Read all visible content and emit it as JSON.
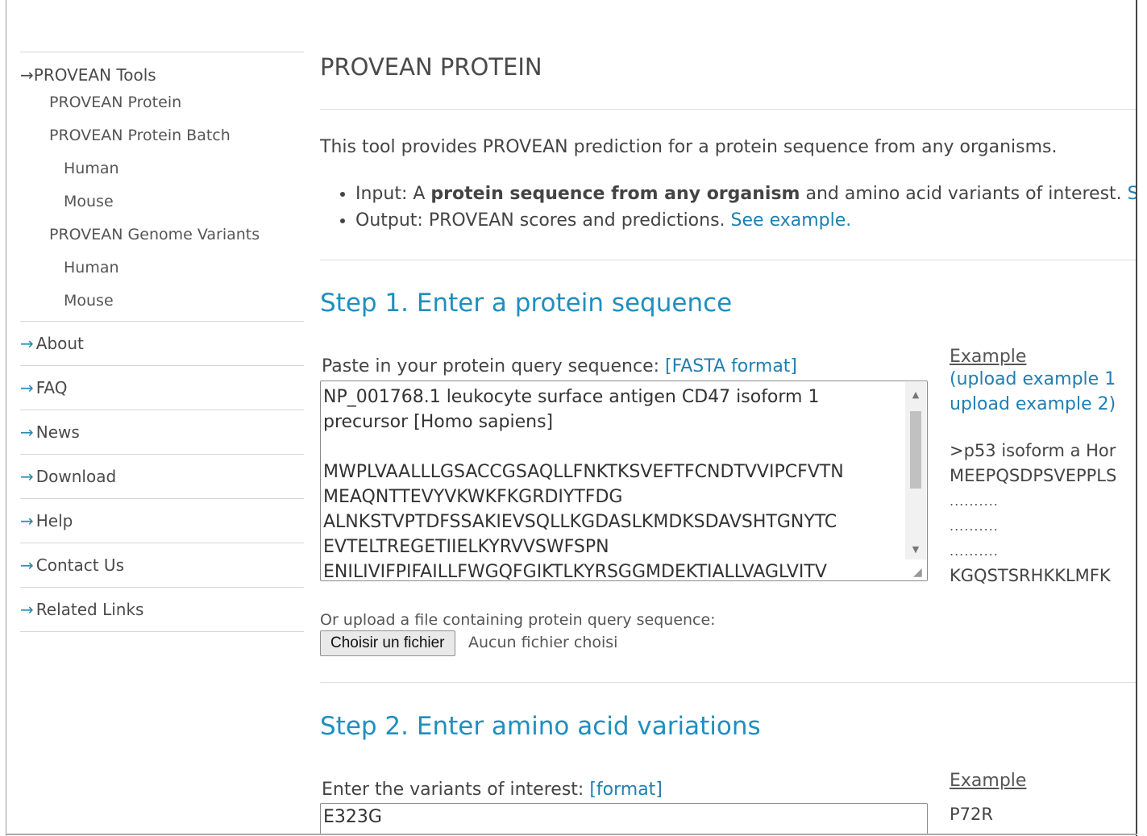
{
  "sidebar": {
    "tools_heading": "PROVEAN Tools",
    "protein": "PROVEAN Protein",
    "protein_batch": "PROVEAN Protein Batch",
    "batch_human": "Human",
    "batch_mouse": "Mouse",
    "genome_variants": "PROVEAN Genome Variants",
    "genome_human": "Human",
    "genome_mouse": "Mouse",
    "about": "About",
    "faq": "FAQ",
    "news": "News",
    "download": "Download",
    "help": "Help",
    "contact": "Contact Us",
    "related_links": "Related Links"
  },
  "main": {
    "title": "PROVEAN PROTEIN",
    "intro": "This tool provides PROVEAN prediction for a protein sequence from any organisms.",
    "bullet_input_prefix": "Input: A ",
    "bullet_input_bold": "protein sequence from any organism",
    "bullet_input_suffix": " and amino acid variants of interest. ",
    "bullet_input_link": "S",
    "bullet_output_prefix": "Output: PROVEAN scores and predictions. ",
    "bullet_output_link": "See example."
  },
  "step1": {
    "heading": "Step 1. Enter a protein sequence",
    "paste_label": "Paste in your protein query sequence: ",
    "fasta_link": "[FASTA format]",
    "sequence": "NP_001768.1 leukocyte surface antigen CD47 isoform 1\nprecursor [Homo sapiens]\n\nMWPLVAALLLGSACCGSAQLLFNKTKSVEFTFCNDTVVIPCFVTN\nMEAQNTTEVYVKWKFKGRDIYTFDG\nALNKSTVPTDFSSAKIEVSQLLKGDASLKMDKSDAVSHTGNYTC\nEVTELTREGETIIELKYRVVSWFSPN\nENILIVIFPIFAILLFWGQFGIKTLKYRSGGMDEKTIALLVAGLVITV",
    "upload_label": "Or upload a file containing protein query sequence:",
    "choose_file": "Choisir un fichier",
    "no_file": "Aucun fichier choisi",
    "example_heading": "Example",
    "upload_example_1": "(upload example 1",
    "upload_example_2": "upload example 2)",
    "example_line_1": ">p53 isoform a Hor",
    "example_line_2": "MEEPQSDPSVEPPLS",
    "example_dots_1": "..........",
    "example_dots_2": "..........",
    "example_dots_3": "..........",
    "example_line_3": "KGQSTSRHKKLMFK"
  },
  "step2": {
    "heading": "Step 2. Enter amino acid variations",
    "variants_label": "Enter the variants of interest: ",
    "format_link": "[format]",
    "variants_value": "E323G",
    "example_heading": "Example",
    "example_line_1": "P72R"
  },
  "colors": {
    "link": "#1f7fb2",
    "step_heading": "#1f8fbf",
    "arrow": "#2a8bb5"
  }
}
